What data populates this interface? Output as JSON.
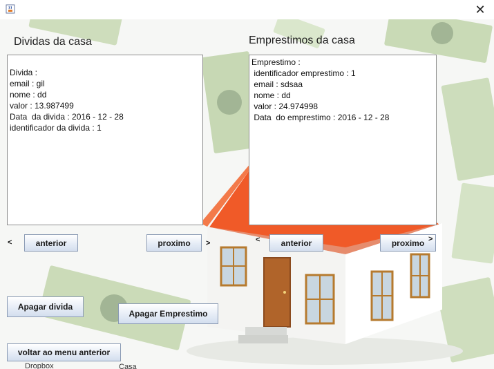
{
  "window": {
    "close_glyph": "✕",
    "icon": "java-cup-icon"
  },
  "dividas": {
    "heading": "Dividas da casa",
    "lines": [
      "Divida :",
      "email : gil",
      "nome : dd",
      "valor : 13.987499",
      "Data  da divida : 2016 - 12 - 28",
      "identificador da divida : 1"
    ],
    "prev_arrow": "<",
    "prev_label": "anterior",
    "next_label": "proximo",
    "next_arrow": ">"
  },
  "emprestimos": {
    "heading": "Emprestimos da casa",
    "lines": [
      "Emprestimo :",
      " identificador emprestimo : 1",
      " email : sdsaa",
      " nome : dd",
      " valor : 24.974998",
      " Data  do emprestimo : 2016 - 12 - 28"
    ],
    "prev_arrow": "<",
    "prev_label": "anterior",
    "next_label": "proximo",
    "next_arrow": ">"
  },
  "actions": {
    "apagar_divida": "Apagar divida",
    "apagar_emprestimo": "Apagar Emprestimo",
    "voltar": "voltar ao menu anterior"
  },
  "taskbar_fragments": [
    "Dropbox",
    "Casa"
  ],
  "colors": {
    "roof": "#f05a28",
    "wall": "#ffffff",
    "door": "#b0642a",
    "money": "#b9cfa4"
  }
}
